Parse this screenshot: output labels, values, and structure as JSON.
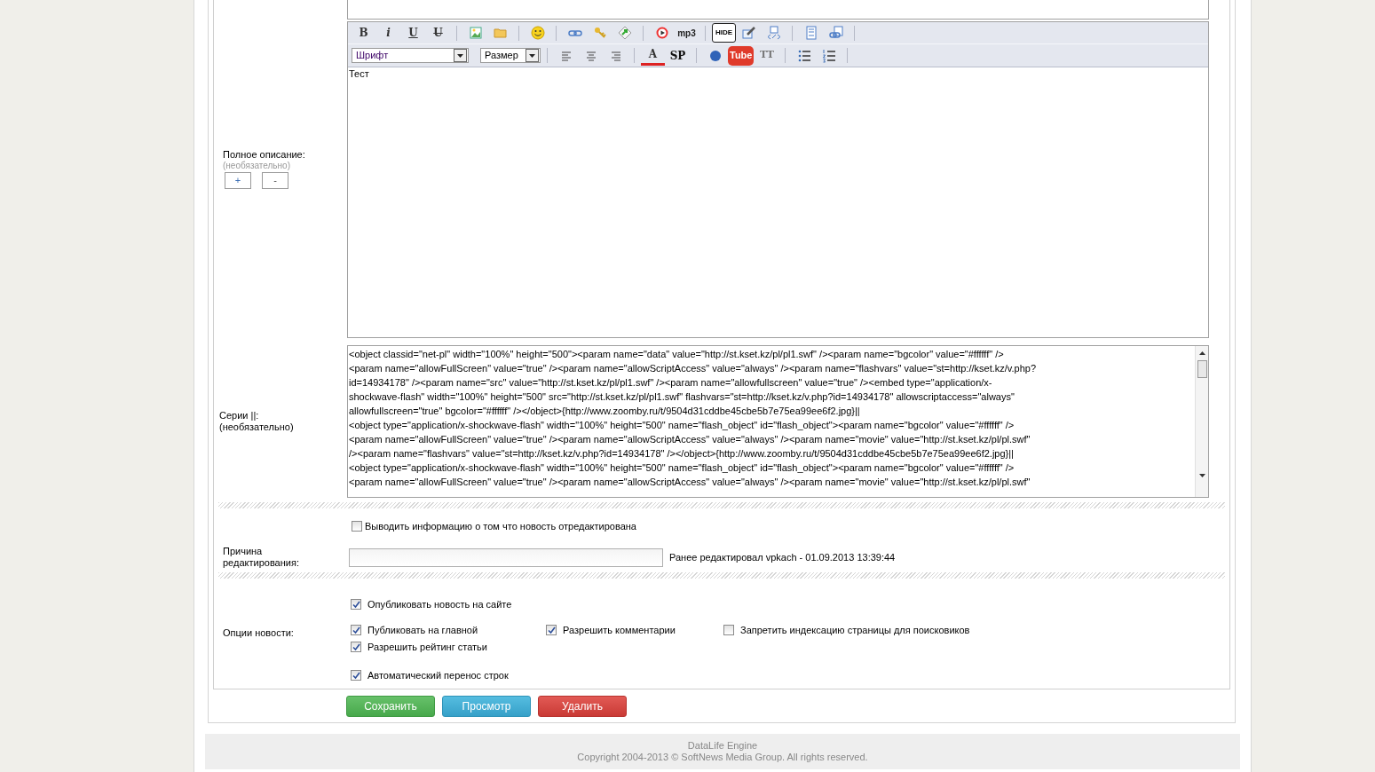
{
  "full_description": {
    "label": "Полное описание:",
    "hint": "(необязательно)",
    "expand_button": "+",
    "collapse_button": "-",
    "toolbar": [
      [
        {
          "kind": "text",
          "label": "B"
        },
        {
          "kind": "text",
          "label": "i"
        },
        {
          "kind": "text",
          "label": "U"
        },
        {
          "kind": "text",
          "label": "U"
        },
        {
          "kind": "separator"
        },
        {
          "kind": "icon"
        },
        {
          "kind": "icon"
        },
        {
          "kind": "separator"
        },
        {
          "kind": "icon"
        },
        {
          "kind": "separator"
        },
        {
          "kind": "icon"
        },
        {
          "kind": "icon"
        },
        {
          "kind": "icon"
        },
        {
          "kind": "separator"
        },
        {
          "kind": "icon"
        },
        {
          "kind": "text",
          "label": "mp3"
        },
        {
          "kind": "separator"
        },
        {
          "kind": "text",
          "label": "HIDE"
        },
        {
          "kind": "icon"
        },
        {
          "kind": "icon"
        },
        {
          "kind": "separator"
        },
        {
          "kind": "icon"
        },
        {
          "kind": "icon"
        },
        {
          "kind": "separator"
        }
      ],
      [
        {
          "kind": "select",
          "label": "Шрифт"
        },
        {
          "kind": "select",
          "label": "Размер"
        },
        {
          "kind": "separator"
        },
        {
          "kind": "icon"
        },
        {
          "kind": "icon"
        },
        {
          "kind": "icon"
        },
        {
          "kind": "separator"
        },
        {
          "kind": "text",
          "label": "A"
        },
        {
          "kind": "text",
          "label": "SP"
        },
        {
          "kind": "separator"
        },
        {
          "kind": "icon"
        },
        {
          "kind": "text",
          "label": "Tube"
        },
        {
          "kind": "text",
          "label": "TT"
        },
        {
          "kind": "separator"
        },
        {
          "kind": "icon"
        },
        {
          "kind": "icon"
        },
        {
          "kind": "separator"
        }
      ]
    ],
    "content": "Тест"
  },
  "series": {
    "label": "Серии ||:",
    "hint": "(необязательно)",
    "lines": [
      "<object classid=\"net-pl\" width=\"100%\" height=\"500\"><param name=\"data\" value=\"http://st.kset.kz/pl/pl1.swf\" /><param name=\"bgcolor\" value=\"#ffffff\" />",
      "<param name=\"allowFullScreen\" value=\"true\" /><param name=\"allowScriptAccess\" value=\"always\" /><param name=\"flashvars\" value=\"st=http://kset.kz/v.php?",
      "id=14934178\" /><param name=\"src\" value=\"http://st.kset.kz/pl/pl1.swf\" /><param name=\"allowfullscreen\" value=\"true\" /><embed type=\"application/x-",
      "shockwave-flash\" width=\"100%\" height=\"500\" src=\"http://st.kset.kz/pl/pl1.swf\" flashvars=\"st=http://kset.kz/v.php?id=14934178\" allowscriptaccess=\"always\"",
      "allowfullscreen=\"true\" bgcolor=\"#ffffff\" /></object>{http://www.zoomby.ru/t/9504d31cddbe45cbe5b7e75ea99ee6f2.jpg}||",
      "<object type=\"application/x-shockwave-flash\" width=\"100%\" height=\"500\" name=\"flash_object\" id=\"flash_object\"><param name=\"bgcolor\" value=\"#ffffff\" />",
      "<param name=\"allowFullScreen\" value=\"true\" /><param name=\"allowScriptAccess\" value=\"always\" /><param name=\"movie\" value=\"http://st.kset.kz/pl/pl.swf\"",
      "/><param name=\"flashvars\" value=\"st=http://kset.kz/v.php?id=14934178\" /></object>{http://www.zoomby.ru/t/9504d31cddbe45cbe5b7e75ea99ee6f2.jpg}||",
      "<object type=\"application/x-shockwave-flash\" width=\"100%\" height=\"500\" name=\"flash_object\" id=\"flash_object\"><param name=\"bgcolor\" value=\"#ffffff\" />",
      "<param name=\"allowFullScreen\" value=\"true\" /><param name=\"allowScriptAccess\" value=\"always\" /><param name=\"movie\" value=\"http://st.kset.kz/pl/pl.swf\""
    ]
  },
  "edited_notice": {
    "label": "Выводить информацию о том что новость отредактирована",
    "checked": false
  },
  "edit_reason": {
    "label": "Причина редактирования:",
    "info": "Ранее редактировал vpkach - 01.09.2013 13:39:44"
  },
  "options": {
    "label": "Опции новости:",
    "rows": [
      [
        {
          "label": "Опубликовать новость на сайте",
          "checked": true
        }
      ],
      [
        {
          "label": "Публиковать на главной",
          "checked": true
        },
        {
          "label": "Разрешить комментарии",
          "checked": true
        },
        {
          "label": "Запретить индексацию страницы для поисковиков",
          "checked": false
        }
      ],
      [
        {
          "label": "Разрешить рейтинг статьи",
          "checked": true
        }
      ],
      [
        {
          "label": "Автоматический перенос строк",
          "checked": true
        }
      ]
    ]
  },
  "buttons": [
    {
      "kind": "save",
      "label": "Сохранить"
    },
    {
      "kind": "preview",
      "label": "Просмотр"
    },
    {
      "kind": "delete",
      "label": "Удалить"
    }
  ],
  "footer": [
    "DataLife Engine",
    "Copyright 2004-2013 © SoftNews Media Group. All rights reserved."
  ]
}
